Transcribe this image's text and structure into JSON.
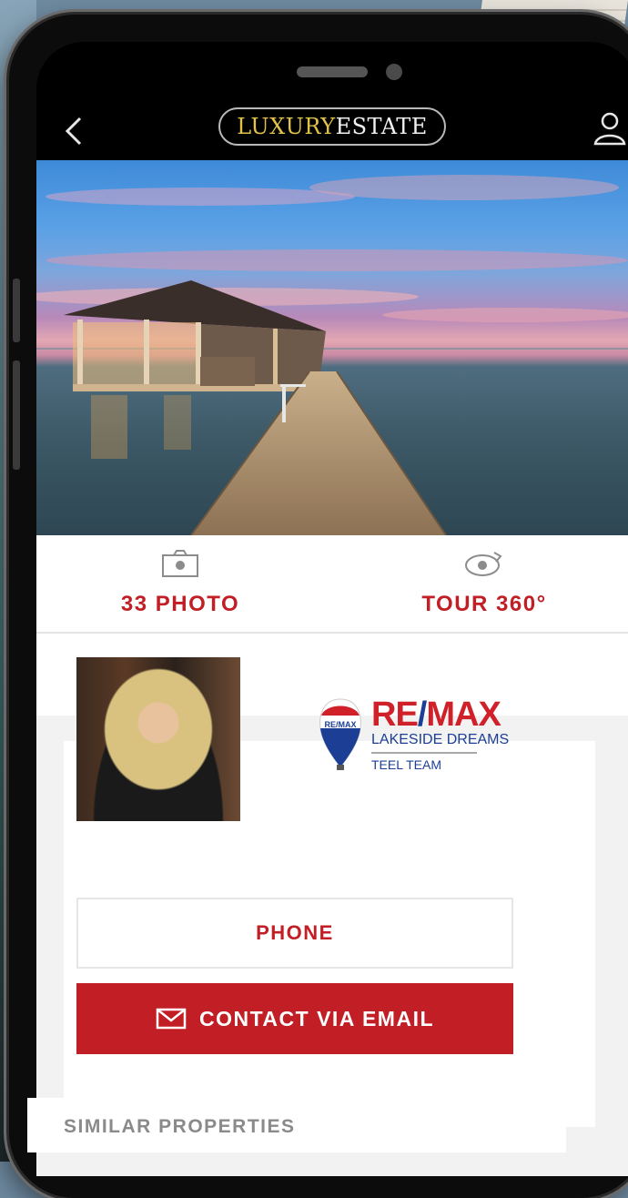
{
  "app": {
    "brand_part1": "LUXURY",
    "brand_part2": "ESTATE",
    "accent_color": "#c21e25",
    "logo_gold": "#e2c24b"
  },
  "topbar": {
    "back_icon": "chevron-left-icon",
    "user_icon": "user-icon"
  },
  "media": {
    "photos_label": "33 PHOTO",
    "photos_icon": "camera-icon",
    "tour_label": "TOUR 360°",
    "tour_icon": "rotate-360-icon"
  },
  "agent": {
    "brokerage_logo_text": "RE/MAX",
    "brokerage_line1": "LAKESIDE DREAMS",
    "brokerage_line2": "TEEL TEAM",
    "balloon_text": "RE/MAX"
  },
  "actions": {
    "phone_label": "PHONE",
    "email_label": "CONTACT VIA EMAIL",
    "email_icon": "envelope-icon"
  },
  "similar": {
    "title": "SIMILAR PROPERTIES"
  }
}
